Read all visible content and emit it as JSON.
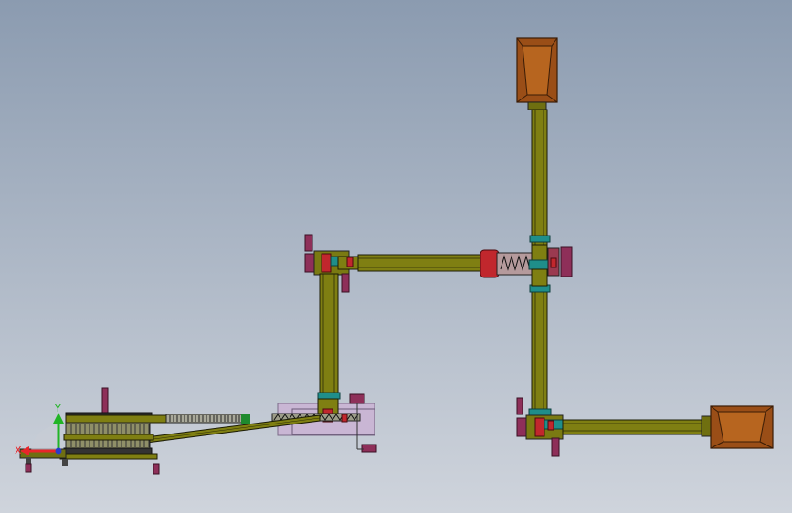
{
  "viewport": {
    "background_top": "#8b9bb0",
    "background_bottom": "#cfd4dc"
  },
  "triad": {
    "x_label": "X",
    "y_label": "Y",
    "x_color": "#e8262b",
    "y_color": "#21b526",
    "z_color": "#2a3cc8"
  },
  "colors": {
    "conveyor": "#7f7f12",
    "conveyor_edge": "#1c1c05",
    "hopper": "#9a4e17",
    "hopper_inner": "#b7651f",
    "motor": "#8e2f59",
    "red_part": "#c1272d",
    "teal_part": "#1f8e8a",
    "frame": "#555555",
    "platform": "#c9b6d4"
  },
  "components": [
    "hopper-top",
    "hopper-right",
    "vertical-conveyor-right",
    "horizontal-conveyor-top",
    "vertical-conveyor-middle",
    "inclined-conveyor",
    "processing-line",
    "horizontal-conveyor-bottom"
  ]
}
